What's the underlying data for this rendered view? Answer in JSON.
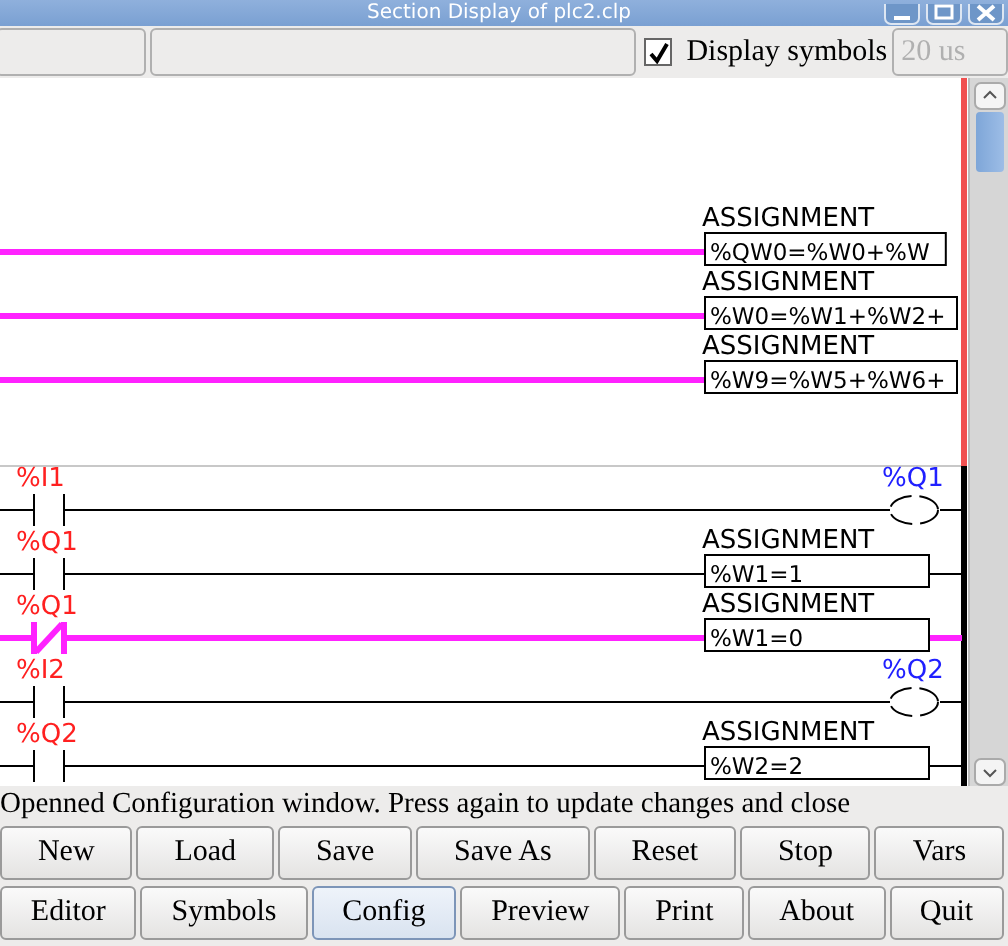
{
  "window": {
    "title": "Section Display of plc2.clp"
  },
  "toolbar": {
    "display_symbols": {
      "label": "Display symbols",
      "checked": true
    },
    "period_field": {
      "value": "20 us",
      "disabled": true
    }
  },
  "ladder": {
    "rung_groups": [
      {
        "highlighted": true,
        "rungs": [
          {
            "energized": true,
            "output": {
              "kind": "assignment",
              "title": "ASSIGNMENT",
              "expression": "%QW0=%W0+%W"
            }
          },
          {
            "energized": true,
            "output": {
              "kind": "assignment",
              "title": "ASSIGNMENT",
              "expression": "%W0=%W1+%W2+"
            }
          },
          {
            "energized": true,
            "output": {
              "kind": "assignment",
              "title": "ASSIGNMENT",
              "expression": "%W9=%W5+%W6+"
            }
          }
        ]
      },
      {
        "highlighted": false,
        "rungs": [
          {
            "energized": false,
            "contact": {
              "label": "%I1",
              "kind": "normal"
            },
            "output": {
              "kind": "coil",
              "label": "%Q1"
            }
          },
          {
            "energized": false,
            "contact": {
              "label": "%Q1",
              "kind": "normal"
            },
            "output": {
              "kind": "assignment",
              "title": "ASSIGNMENT",
              "expression": "%W1=1"
            }
          },
          {
            "energized": true,
            "contact": {
              "label": "%Q1",
              "kind": "negated"
            },
            "output": {
              "kind": "assignment",
              "title": "ASSIGNMENT",
              "expression": "%W1=0"
            }
          },
          {
            "energized": false,
            "contact": {
              "label": "%I2",
              "kind": "normal"
            },
            "output": {
              "kind": "coil",
              "label": "%Q2"
            }
          },
          {
            "energized": false,
            "contact": {
              "label": "%Q2",
              "kind": "normal"
            },
            "output": {
              "kind": "assignment",
              "title": "ASSIGNMENT",
              "expression": "%W2=2"
            }
          }
        ]
      }
    ]
  },
  "status_bar": "Openned Configuration window. Press again to update changes and close",
  "button_rows": [
    [
      {
        "label": "New",
        "selected": false
      },
      {
        "label": "Load",
        "selected": false
      },
      {
        "label": "Save",
        "selected": false
      },
      {
        "label": "Save As",
        "selected": false
      },
      {
        "label": "Reset",
        "selected": false
      },
      {
        "label": "Stop",
        "selected": false
      },
      {
        "label": "Vars",
        "selected": false
      }
    ],
    [
      {
        "label": "Editor",
        "selected": false
      },
      {
        "label": "Symbols",
        "selected": false
      },
      {
        "label": "Config",
        "selected": true
      },
      {
        "label": "Preview",
        "selected": false
      },
      {
        "label": "Print",
        "selected": false
      },
      {
        "label": "About",
        "selected": false
      },
      {
        "label": "Quit",
        "selected": false
      }
    ]
  ]
}
